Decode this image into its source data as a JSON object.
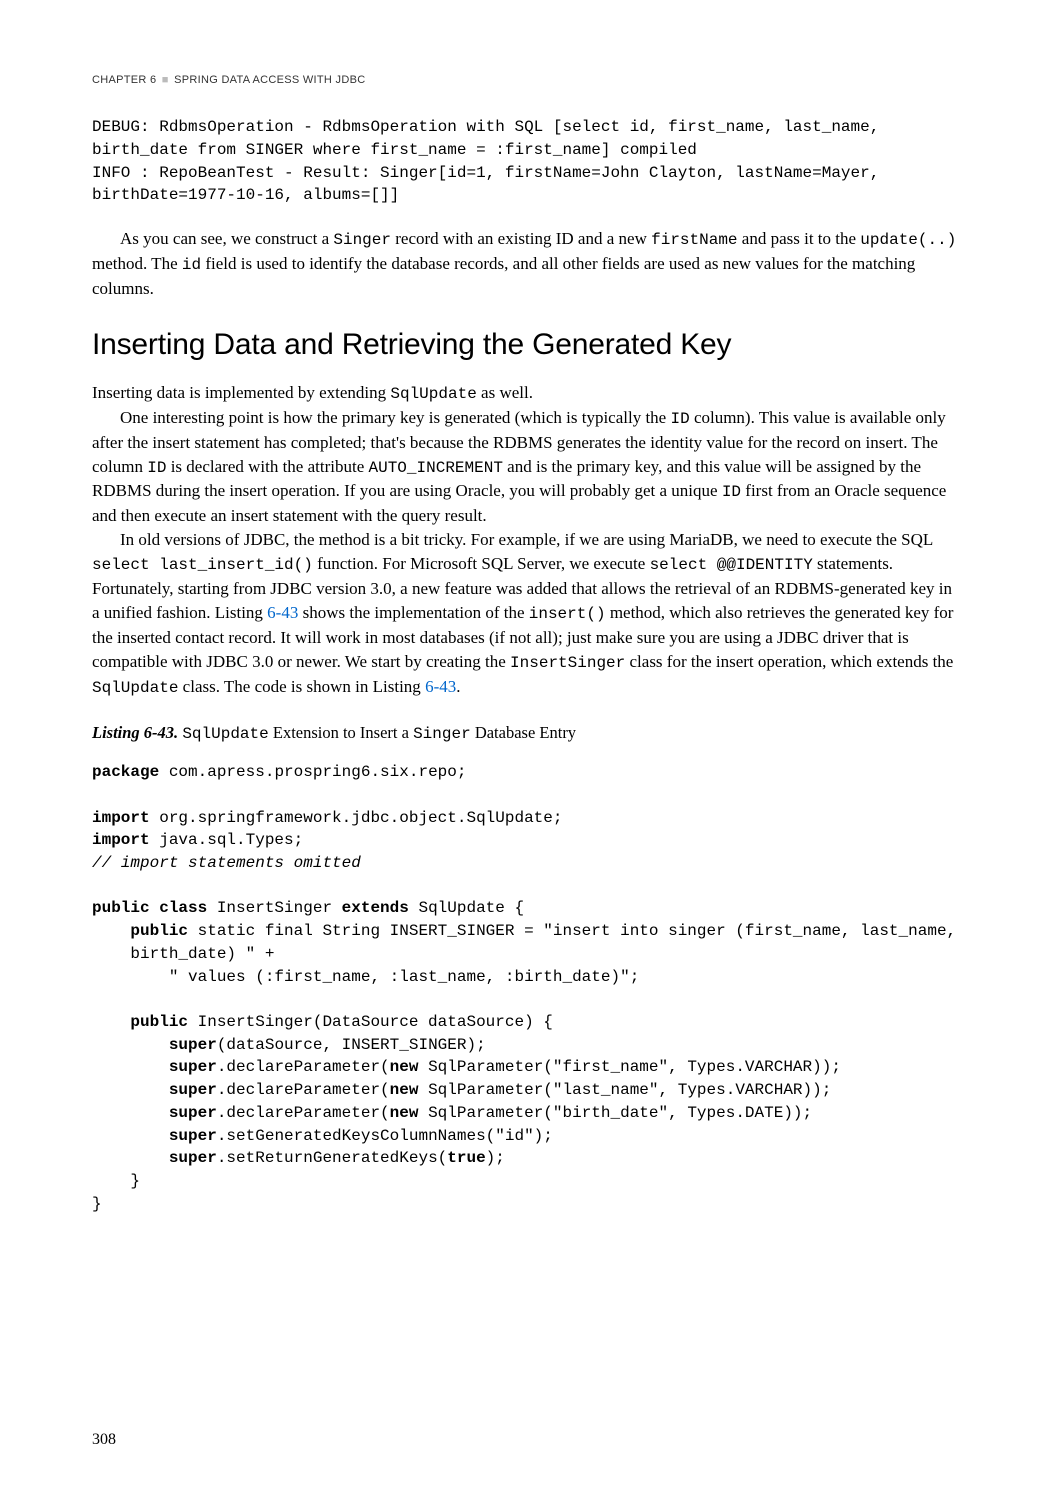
{
  "header": {
    "chapter_label": "Chapter 6",
    "separator": "■",
    "chapter_title": "Spring Data Access with JDBC"
  },
  "debug_block": "DEBUG: RdbmsOperation - RdbmsOperation with SQL [select id, first_name, last_name,\nbirth_date from SINGER where first_name = :first_name] compiled\nINFO : RepoBeanTest - Result: Singer[id=1, firstName=John Clayton, lastName=Mayer,\nbirthDate=1977-10-16, albums=[]]",
  "para1_pre": "As you can see, we construct a ",
  "para1_code1": "Singer",
  "para1_mid1": " record with an existing ID and a new ",
  "para1_code2": "firstName",
  "para1_mid2": " and pass it to the ",
  "para1_code3": "update(..)",
  "para1_mid3": " method. The ",
  "para1_code4": "id",
  "para1_post": " field is used to identify the database records, and all other fields are used as new values for the matching columns.",
  "section_title": "Inserting Data and Retrieving the Generated Key",
  "para2_pre": "Inserting data is implemented by extending ",
  "para2_code1": "SqlUpdate",
  "para2_post": " as well.",
  "para3_pre": "One interesting point is how the primary key is generated (which is typically the ",
  "para3_code1": "ID",
  "para3_mid1": " column). This value is available only after the insert statement has completed; that's because the RDBMS generates the identity value for the record on insert. The column ",
  "para3_code2": "ID",
  "para3_mid2": " is declared with the attribute ",
  "para3_code3": "AUTO_INCREMENT",
  "para3_mid3": " and is the primary key, and this value will be assigned by the RDBMS during the insert operation. If you are using Oracle, you will probably get a unique ",
  "para3_code4": "ID",
  "para3_post": " first from an Oracle sequence and then execute an insert statement with the query result.",
  "para4_pre": "In old versions of JDBC, the method is a bit tricky. For example, if we are using MariaDB, we need to execute the SQL ",
  "para4_code1": "select  last_insert_id()",
  "para4_mid1": " function. For Microsoft SQL Server, we execute ",
  "para4_code2": "select @@IDENTITY",
  "para4_mid2": " statements. Fortunately, starting from JDBC version 3.0, a new feature was added that allows the retrieval of an RDBMS-generated key in a unified fashion. Listing ",
  "para4_link1": "6-43",
  "para4_mid3": " shows the implementation of the ",
  "para4_code3": "insert()",
  "para4_mid4": " method, which also retrieves the generated key for the inserted contact record. It will work in most databases (if not all); just make sure you are using a JDBC driver that is compatible with JDBC 3.0 or newer. We start by creating the ",
  "para4_code4": "InsertSinger",
  "para4_mid5": " class for the insert operation, which extends the ",
  "para4_code5": "SqlUpdate",
  "para4_mid6": " class. The code is shown in Listing ",
  "para4_link2": "6-43",
  "para4_post": ".",
  "listing": {
    "label": "Listing 6-43.",
    "desc_pre": " ",
    "desc_code1": "SqlUpdate",
    "desc_mid": " Extension to Insert a ",
    "desc_code2": "Singer",
    "desc_post": " Database Entry"
  },
  "code": {
    "l1_kw": "package",
    "l1_rest": " com.apress.prospring6.six.repo;",
    "l2_kw": "import",
    "l2_rest": " org.springframework.jdbc.object.SqlUpdate;",
    "l3_kw": "import",
    "l3_rest": " java.sql.Types;",
    "l4": "// import statements omitted",
    "l5_kw1": "public class",
    "l5_mid1": " InsertSinger ",
    "l5_kw2": "extends",
    "l5_rest": " SqlUpdate {",
    "l6_kw": "public",
    "l6_rest": " static final String INSERT_SINGER = \"insert into singer (first_name, last_name,",
    "l7": "    birth_date) \" +",
    "l8": "        \" values (:first_name, :last_name, :birth_date)\";",
    "l9_kw": "public",
    "l9_rest": " InsertSinger(DataSource dataSource) {",
    "l10_kw": "super",
    "l10_rest": "(dataSource, INSERT_SINGER);",
    "l11_kw1": "super",
    "l11_mid": ".declareParameter(",
    "l11_kw2": "new",
    "l11_rest": " SqlParameter(\"first_name\", Types.VARCHAR));",
    "l12_kw1": "super",
    "l12_mid": ".declareParameter(",
    "l12_kw2": "new",
    "l12_rest": " SqlParameter(\"last_name\", Types.VARCHAR));",
    "l13_kw1": "super",
    "l13_mid": ".declareParameter(",
    "l13_kw2": "new",
    "l13_rest": " SqlParameter(\"birth_date\", Types.DATE));",
    "l14_kw": "super",
    "l14_rest": ".setGeneratedKeysColumnNames(\"id\");",
    "l15_kw1": "super",
    "l15_mid": ".setReturnGeneratedKeys(",
    "l15_kw2": "true",
    "l15_rest": ");",
    "l16": "    }",
    "l17": "}"
  },
  "page_number": "308"
}
